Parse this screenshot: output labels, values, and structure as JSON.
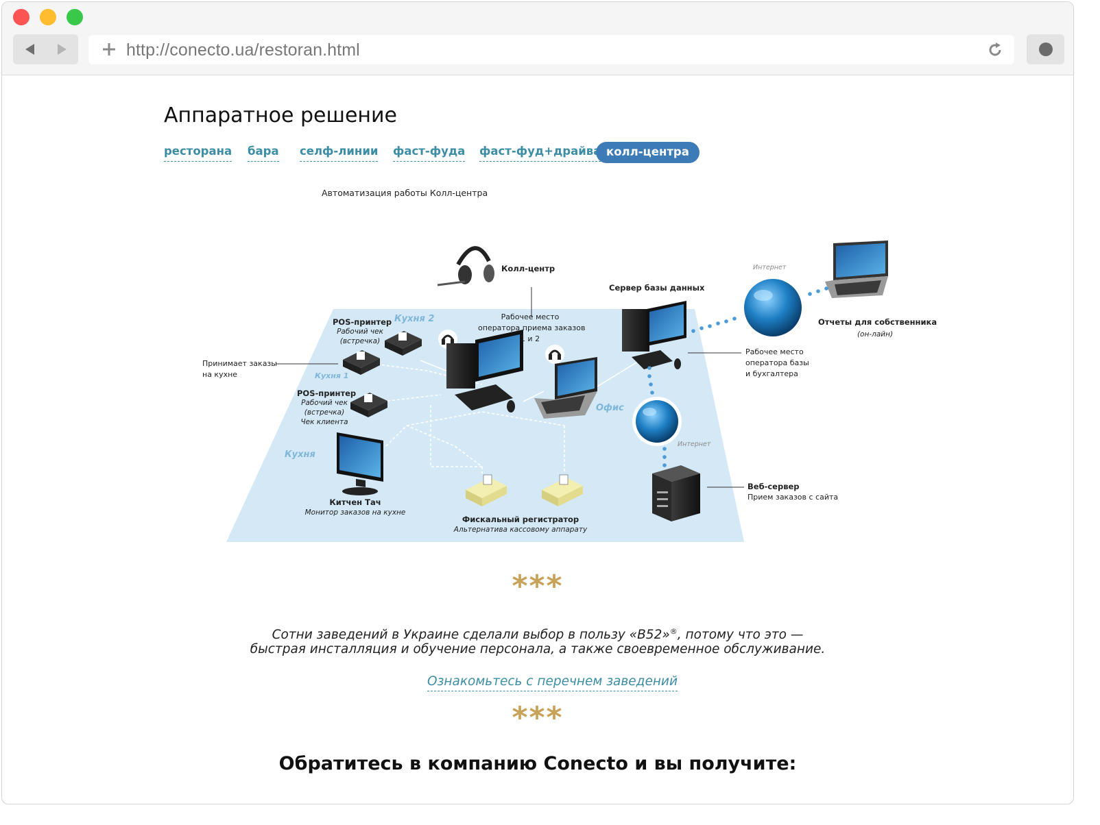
{
  "browser": {
    "url": "http://conecto.ua/restoran.html"
  },
  "page": {
    "title": "Аппаратное решение",
    "tabs": [
      {
        "label": "ресторана",
        "active": false
      },
      {
        "label": "бара",
        "active": false
      },
      {
        "label": "селф-линии",
        "active": false
      },
      {
        "label": "фаст-фуда",
        "active": false
      },
      {
        "label": "фаст-фуд+драйва",
        "active": false
      },
      {
        "label": "колл-центра",
        "active": true
      }
    ],
    "diagram_caption": "Автоматизация работы Колл-центра",
    "diagram": {
      "call_center": "Колл-центр",
      "db_server": "Сервер базы данных",
      "internet_top": "Интернет",
      "owner_reports": "Отчеты для собственника",
      "owner_reports_sub": "(он-лайн)",
      "pos_printer_1": "POS-принтер",
      "pos_printer_1_sub1": "Рабочий чек",
      "pos_printer_1_sub2": "(встречка)",
      "kitchen_2": "Кухня 2",
      "operator_workplace": "Рабочее место",
      "operator_workplace_2": "оператора приема заказов",
      "operator_workplace_3": "1 и 2",
      "accepts_orders": "Принимает заказы",
      "accepts_orders_2": "на кухне",
      "kitchen_1": "Кухня 1",
      "pos_printer_2": "POS-принтер",
      "pos_printer_2_sub1": "Рабочий чек",
      "pos_printer_2_sub2": "(встречка)",
      "pos_printer_2_sub3": "Чек клиента",
      "db_operator": "Рабочее место",
      "db_operator_2": "оператора базы",
      "db_operator_3": "и бухгалтера",
      "office": "Офис",
      "internet_mid": "Интернет",
      "kitchen": "Кухня",
      "kitchen_touch": "Китчен Тач",
      "kitchen_touch_sub": "Монитор заказов на кухне",
      "fiscal": "Фискальный регистратор",
      "fiscal_sub": "Альтернатива кассовому аппарату",
      "web_server": "Веб-сервер",
      "web_server_sub": "Прием заказов с сайта"
    },
    "stars": "***",
    "quote_line1_a": "Сотни заведений в Украине сделали выбор в пользу «В52»",
    "quote_reg": "®",
    "quote_line1_b": ", потому что это —",
    "quote_line2": "быстрая инсталляция и обучение персонала, а также своевременное обслуживание.",
    "list_link": "Ознакомьтесь с перечнем заведений",
    "cta": "Обратитесь в компанию Conecto и вы получите:"
  },
  "colors": {
    "accent_link": "#3d8ea4",
    "active_tab": "#3d7bb7",
    "stars": "#c7a35a",
    "floor": "#d4e8f6"
  }
}
